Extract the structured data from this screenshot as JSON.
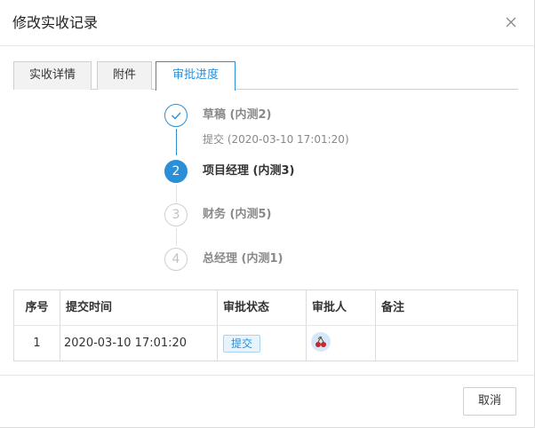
{
  "dialog": {
    "title": "修改实收记录",
    "cancel_label": "取消"
  },
  "tabs": [
    {
      "label": "实收详情",
      "active": false
    },
    {
      "label": "附件",
      "active": false
    },
    {
      "label": "审批进度",
      "active": true
    }
  ],
  "steps": [
    {
      "number": "",
      "status": "done",
      "title": "草稿 (内测2)",
      "desc": "提交 (2020-03-10 17:01:20)"
    },
    {
      "number": "2",
      "status": "active",
      "title": "项目经理 (内测3)",
      "desc": ""
    },
    {
      "number": "3",
      "status": "wait",
      "title": "财务 (内测5)",
      "desc": ""
    },
    {
      "number": "4",
      "status": "wait",
      "title": "总经理 (内测1)",
      "desc": ""
    }
  ],
  "table": {
    "columns": [
      "序号",
      "提交时间",
      "审批状态",
      "审批人",
      "备注"
    ],
    "rows": [
      {
        "index": "1",
        "time": "2020-03-10 17:01:20",
        "status": "提交",
        "approver": "",
        "remark": ""
      }
    ]
  },
  "colors": {
    "accent": "#2b8fd8",
    "active_step_bg": "#2b8fd8",
    "inactive_step": "#c0c0c0",
    "badge_bg": "#e8f4fd"
  }
}
